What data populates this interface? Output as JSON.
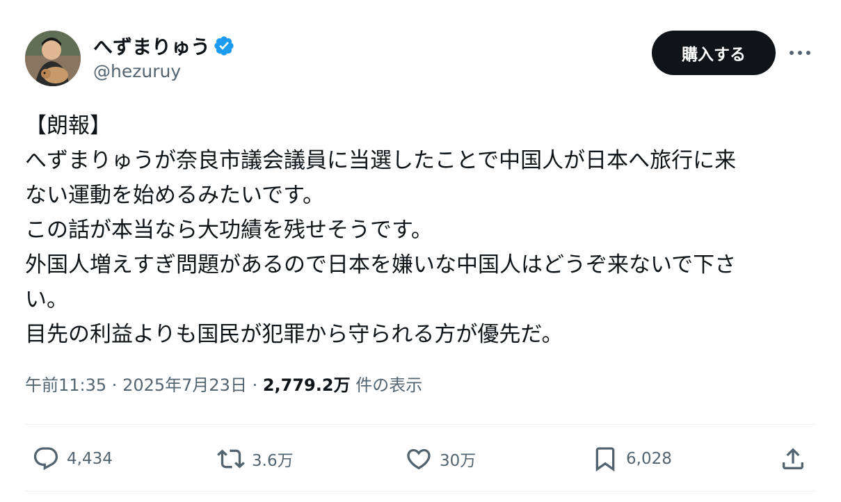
{
  "author": {
    "display_name": "へずまりゅう",
    "handle": "@hezuruy",
    "verified": true
  },
  "header": {
    "buy_button_label": "購入する",
    "more_icon": "more-horizontal-icon"
  },
  "tweet": {
    "lines": [
      "【朗報】",
      "へずまりゅうが奈良市議会議員に当選したことで中国人が日本へ旅行に来",
      "ない運動を始めるみたいです。",
      "この話が本当なら大功績を残せそうです。",
      "外国人増えすぎ問題があるので日本を嫌いな中国人はどうぞ来ないで下さ",
      "い。",
      "目先の利益よりも国民が犯罪から守られる方が優先だ。"
    ]
  },
  "meta": {
    "time": "午前11:35",
    "separator": " · ",
    "date": "2025年7月23日",
    "views_count": "2,779.2万",
    "views_label": " 件の表示"
  },
  "actions": {
    "reply_count": "4,434",
    "retweet_count": "3.6万",
    "like_count": "30万",
    "bookmark_count": "6,028"
  },
  "colors": {
    "text_primary": "#0f1419",
    "text_secondary": "#536471",
    "verified_blue": "#1d9bf0",
    "button_bg": "#0f1419",
    "divider": "#eff3f4"
  }
}
